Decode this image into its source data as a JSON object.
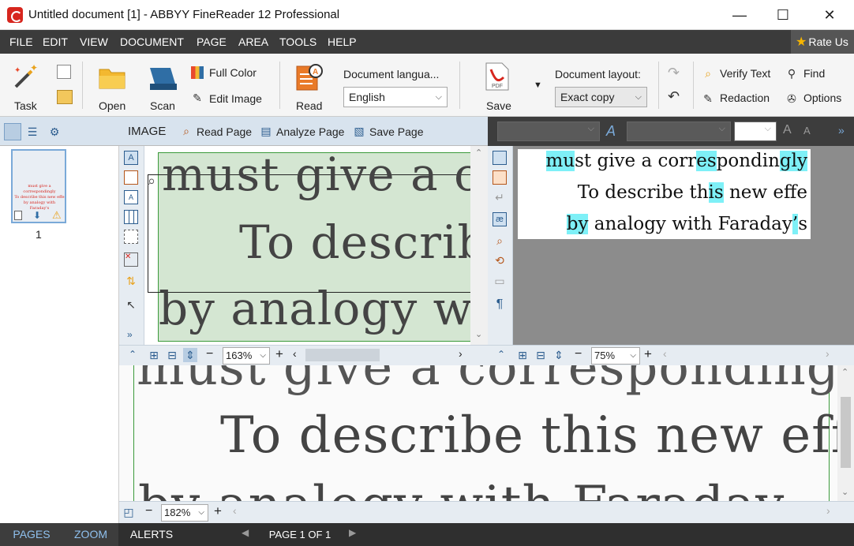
{
  "window": {
    "title": "Untitled document [1] - ABBYY FineReader 12 Professional",
    "minimize": "—",
    "maximize": "☐",
    "close": "✕"
  },
  "menu": [
    "FILE",
    "EDIT",
    "VIEW",
    "DOCUMENT",
    "PAGE",
    "AREA",
    "TOOLS",
    "HELP"
  ],
  "rate_us": "Rate Us",
  "toolbar": {
    "task": "Task",
    "open": "Open",
    "scan": "Scan",
    "full_color": "Full Color",
    "edit_image": "Edit Image",
    "read": "Read",
    "document_language_label": "Document langua...",
    "document_language_value": "English",
    "save": "Save",
    "document_layout_label": "Document layout:",
    "document_layout_value": "Exact copy",
    "verify_text": "Verify Text",
    "find": "Find",
    "redaction": "Redaction",
    "options": "Options"
  },
  "image_panel": {
    "title": "IMAGE",
    "read_page": "Read Page",
    "analyze_page": "Analyze Page",
    "save_page": "Save Page",
    "zoom": "163%",
    "scan_lines": [
      "must give a co",
      "To describe",
      "by  analogy  w"
    ]
  },
  "text_panel": {
    "zoom": "75%",
    "lines": [
      [
        {
          "t": "mu",
          "h": true
        },
        {
          "t": "st give a corr",
          "h": false
        },
        {
          "t": "es",
          "h": true
        },
        {
          "t": "pondin",
          "h": false
        },
        {
          "t": "gly",
          "h": true
        }
      ],
      [
        {
          "t": "To describe th",
          "h": false
        },
        {
          "t": "is",
          "h": true
        },
        {
          "t": " new ",
          "h": false
        },
        {
          "t": "effe",
          "h": false
        }
      ],
      [
        {
          "t": "by",
          "h": true
        },
        {
          "t": " analogy with Faraday",
          "h": false
        },
        {
          "t": "’",
          "h": true
        },
        {
          "t": "s",
          "h": false
        }
      ]
    ]
  },
  "zoom_panel": {
    "zoom": "182%",
    "scan_lines": [
      "must give a correspondingly",
      "To describe this new effe",
      "by  analogy  with  Faraday"
    ]
  },
  "pages_panel": {
    "page_number": "1",
    "thumb_lines": [
      "must give a correspondingly",
      "To describe this new effe",
      "by analogy with Faraday's"
    ]
  },
  "status": {
    "pages": "PAGES",
    "zoom": "ZOOM",
    "alerts": "ALERTS",
    "page_indicator": "PAGE 1 OF 1"
  },
  "colors": {
    "highlight": "#7ef0f7",
    "menubar": "#3b3b3b",
    "accent": "#d7261e"
  }
}
